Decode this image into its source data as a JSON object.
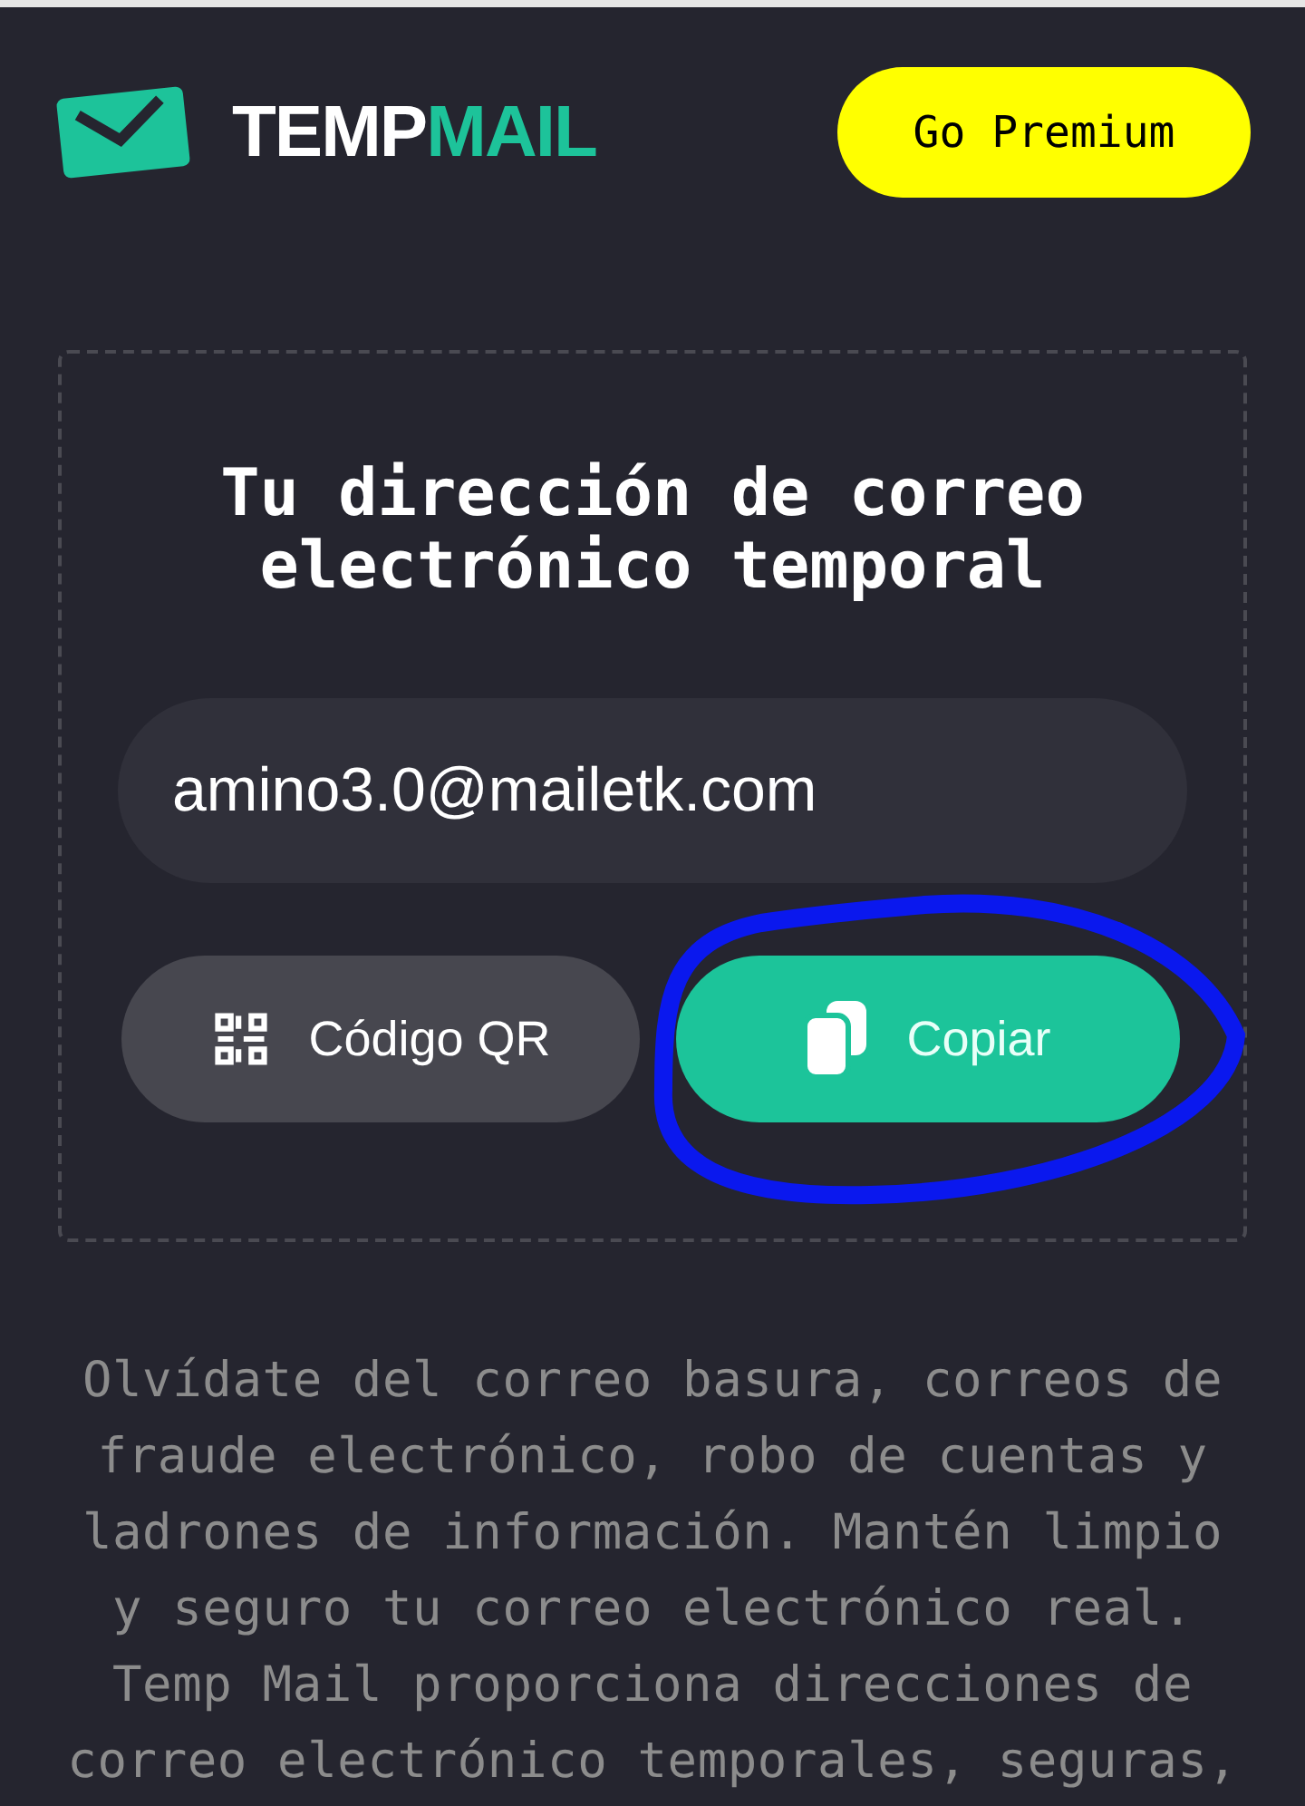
{
  "header": {
    "logo_words": [
      "TEMP",
      "MAIL"
    ],
    "premium_button": "Go Premium"
  },
  "card": {
    "title": "Tu dirección de correo electrónico temporal",
    "email": "amino3.0@mailetk.com",
    "buttons": [
      {
        "kind": "qr",
        "label": "Código QR"
      },
      {
        "kind": "copy",
        "label": "Copiar"
      }
    ]
  },
  "description": "Olvídate del correo basura, correos de fraude electrónico, robo de cuentas y ladrones de información. Mantén limpio y seguro tu correo electrónico real. Temp Mail proporciona direcciones de correo electrónico temporales, seguras,"
}
